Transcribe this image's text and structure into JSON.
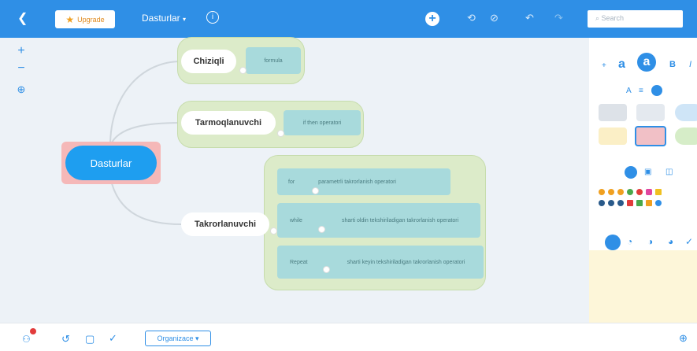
{
  "toolbar": {
    "back_icon": "chevron-left-icon",
    "upgrade_label": "Upgrade",
    "title": "Dasturlar",
    "search_placeholder": "Search"
  },
  "map": {
    "central": "Dasturlar",
    "branches": [
      {
        "label": "Chiziqli",
        "leaves": [
          {
            "key": "",
            "text": "formula"
          }
        ]
      },
      {
        "label": "Tarmoqlanuvchi",
        "leaves": [
          {
            "key": "",
            "text": "if then operatori"
          }
        ]
      },
      {
        "label": "Takrorlanuvchi",
        "leaves": [
          {
            "key": "for",
            "text": "parametrli takrorlanish operatori"
          },
          {
            "key": "while",
            "text": "sharti oldin tekshiriladigan takrorlanish operatori"
          },
          {
            "key": "Repeat",
            "text": "sharti keyin tekshiriladigan takrorlanish operatori"
          }
        ]
      }
    ]
  },
  "bottom": {
    "mode_label": "Organizace"
  },
  "colors": {
    "accent": "#2f8fe6",
    "central_node": "#1e9ef0",
    "central_border": "#f5b8b8",
    "cloud_fill": "#dcebc9",
    "leaf_fill": "#a8dadc"
  }
}
